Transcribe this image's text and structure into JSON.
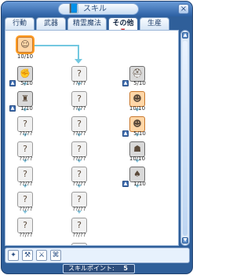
{
  "window": {
    "title": "スキル"
  },
  "tabs": [
    {
      "label": "行動"
    },
    {
      "label": "武器"
    },
    {
      "label": "精霊魔法"
    },
    {
      "label": "その他"
    },
    {
      "label": "生産"
    }
  ],
  "skills": {
    "c1": [
      {
        "level": "10/10",
        "icon": "skill-icon"
      },
      {
        "level": "5/10",
        "icon": "skill-icon"
      },
      {
        "level": "1/10",
        "icon": "skill-icon"
      },
      {
        "level": "??/??",
        "icon": "skill-icon"
      },
      {
        "level": "??/??",
        "icon": "skill-icon"
      },
      {
        "level": "??/??",
        "icon": "skill-icon"
      },
      {
        "level": "??/??",
        "icon": "skill-icon"
      },
      {
        "level": "??/??",
        "icon": "skill-icon"
      }
    ],
    "c2": [
      {
        "level": "??/??",
        "icon": "skill-icon"
      },
      {
        "level": "??/??",
        "icon": "skill-icon"
      },
      {
        "level": "??/??",
        "icon": "skill-icon"
      },
      {
        "level": "??/??",
        "icon": "skill-icon"
      },
      {
        "level": "??/??",
        "icon": "skill-icon"
      },
      {
        "level": "??/??",
        "icon": "skill-icon"
      },
      {
        "level": "??/??",
        "icon": "skill-icon"
      },
      {
        "level": "??/??",
        "icon": "skill-icon"
      }
    ],
    "c3": [
      {
        "level": "5/10",
        "icon": "hp-skill-icon",
        "badge": "HP"
      },
      {
        "level": "10/10",
        "icon": "skill-icon"
      },
      {
        "level": "5/10",
        "icon": "skill-icon"
      },
      {
        "level": "10/10",
        "icon": "skill-icon"
      },
      {
        "level": "1/10",
        "icon": "skill-icon"
      }
    ]
  },
  "footer": {
    "points_label": "スキルポイント:",
    "points_value": "5"
  },
  "icons": {
    "close": "×",
    "up": "▲",
    "down": "▼"
  }
}
